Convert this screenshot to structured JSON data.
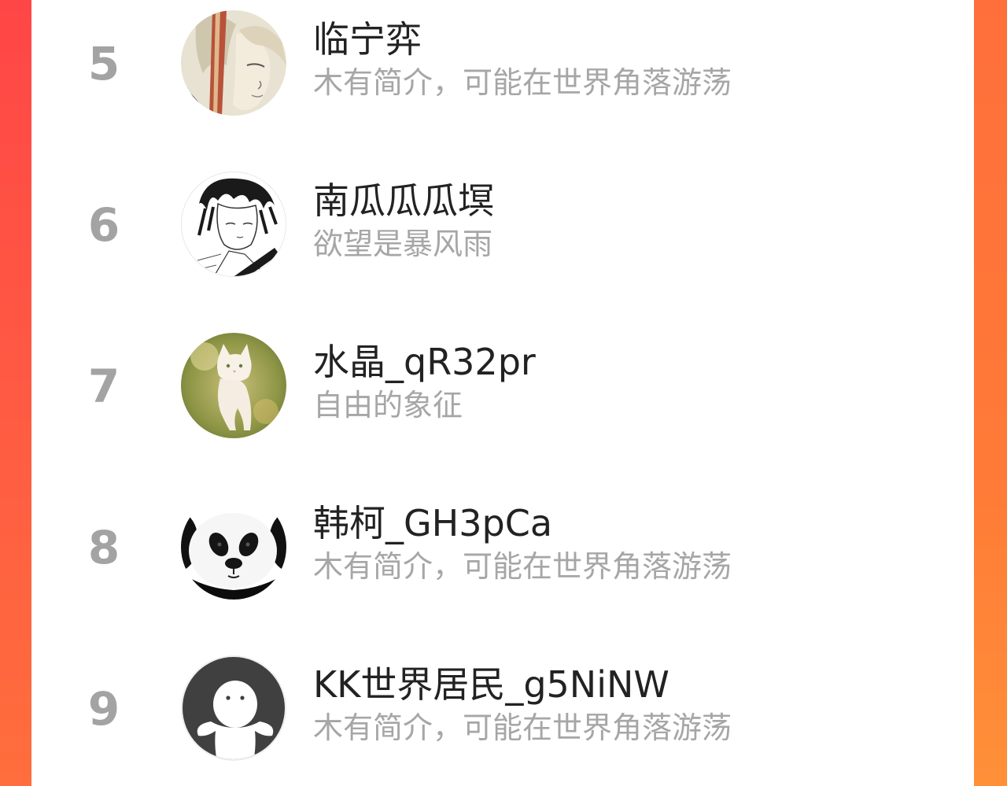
{
  "ranking": {
    "items": [
      {
        "rank": "5",
        "name": "临宁弈",
        "bio": "木有简介，可能在世界角落游荡",
        "avatar_icon": "anime-portrait-avatar"
      },
      {
        "rank": "6",
        "name": "南瓜瓜瓜塓",
        "bio": "欲望是暴风雨",
        "avatar_icon": "sketch-portrait-avatar"
      },
      {
        "rank": "7",
        "name": "水晶_qR32pr",
        "bio": "自由的象征",
        "avatar_icon": "white-cat-avatar"
      },
      {
        "rank": "8",
        "name": "韩柯_GH3pCa",
        "bio": "木有简介，可能在世界角落游荡",
        "avatar_icon": "panda-avatar"
      },
      {
        "rank": "9",
        "name": "KK世界居民_g5NiNW",
        "bio": "木有简介，可能在世界角落游荡",
        "avatar_icon": "default-user-avatar"
      }
    ]
  },
  "colors": {
    "background_gradient_start": "#ff4a4a",
    "background_gradient_end": "#ff8c35",
    "rank_text": "#a3a3a3",
    "name_text": "#222222",
    "bio_text": "#a6a6a6"
  }
}
